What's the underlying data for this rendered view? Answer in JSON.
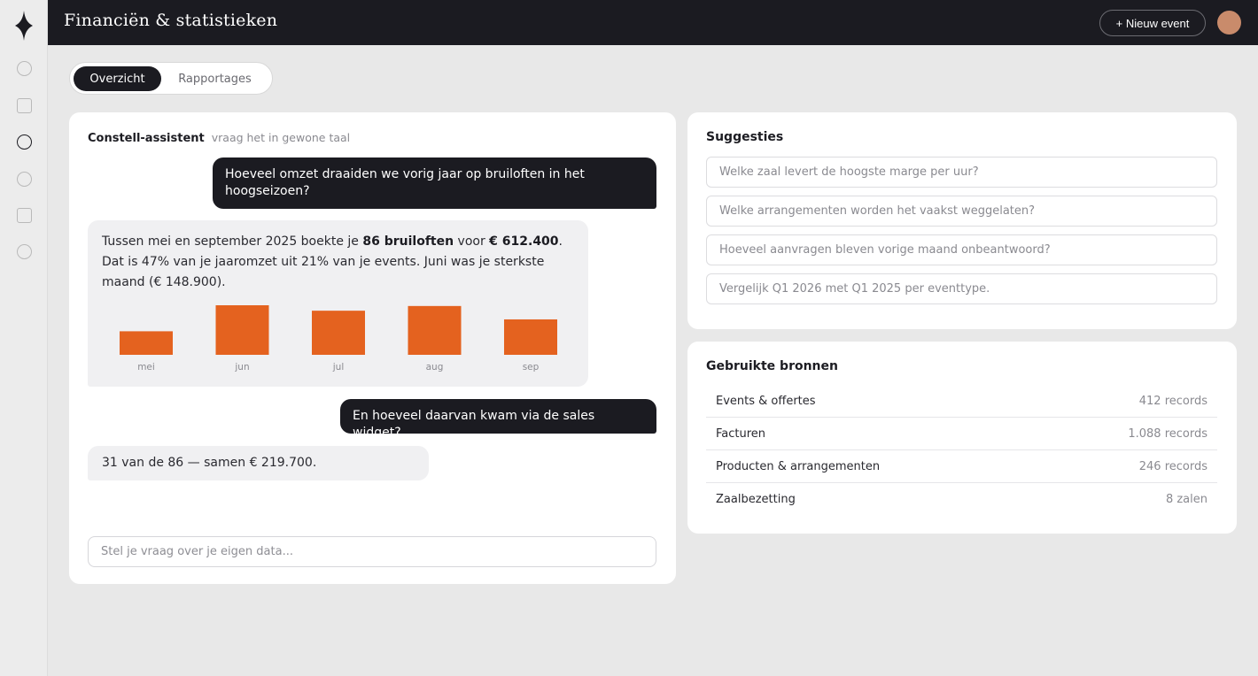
{
  "app": {
    "title": "Financiën & statistieken",
    "new_button": "+ Nieuw event",
    "accent": "#e4621f",
    "dark": "#1b1b21"
  },
  "rail": {
    "icons": [
      "logo-icon",
      "circle-icon",
      "square-icon",
      "circle-icon",
      "circle-icon",
      "square-icon",
      "circle-icon"
    ]
  },
  "tabs": {
    "active": "Overzicht",
    "other": "Rapportages"
  },
  "chat": {
    "title": "Constell-assistent",
    "subtitle": "vraag het in gewone taal",
    "messages": {
      "q1": "Hoeveel omzet draaiden we vorig jaar op bruiloften in het hoogseizoen?",
      "a1_part1": "Tussen mei en september 2025 boekte je ",
      "a1_bold1": "86 bruiloften",
      "a1_part2": " voor ",
      "a1_bold2": "€ 612.400",
      "a1_part3": ". Dat is 47% van je jaaromzet uit 21% van je events. Juni was je sterkste maand (€ 148.900).",
      "q2": "En hoeveel daarvan kwam via de sales widget?",
      "a2": "31 van de 86 — samen € 219.700."
    },
    "input_placeholder": "Stel je vraag over je eigen data..."
  },
  "chart_data": {
    "type": "bar",
    "categories": [
      "mei",
      "jun",
      "jul",
      "aug",
      "sep"
    ],
    "values": [
      95,
      200,
      178,
      197,
      143
    ],
    "ylim": [
      0,
      200
    ],
    "grid": false,
    "color": "#e4621f"
  },
  "suggestions": {
    "title": "Suggesties",
    "items": [
      "Welke zaal levert de hoogste marge per uur?",
      "Welke arrangementen worden het vaakst weggelaten?",
      "Hoeveel aanvragen bleven vorige maand onbeantwoord?",
      "Vergelijk Q1 2026 met Q1 2025 per eventtype."
    ]
  },
  "sources": {
    "title": "Gebruikte bronnen",
    "rows": [
      {
        "name": "Events & offertes",
        "value": "412 records"
      },
      {
        "name": "Facturen",
        "value": "1.088 records"
      },
      {
        "name": "Producten & arrangementen",
        "value": "246 records"
      },
      {
        "name": "Zaalbezetting",
        "value": "8 zalen"
      }
    ]
  }
}
